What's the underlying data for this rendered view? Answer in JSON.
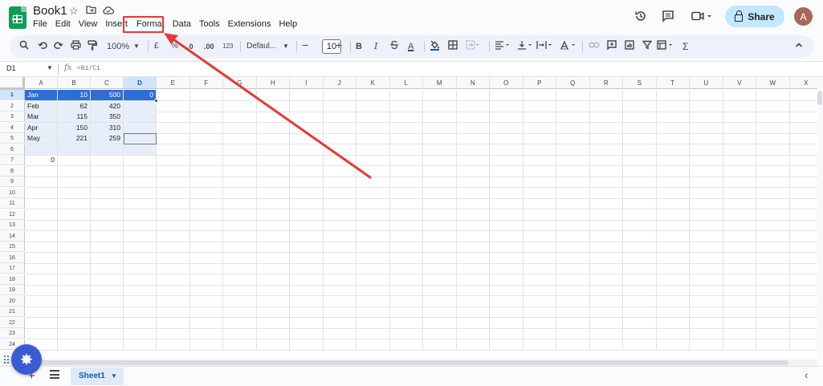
{
  "document": {
    "title": "Book1",
    "title_icons": [
      "star-icon",
      "move-to-folder-icon",
      "cloud-status-icon"
    ]
  },
  "menu": [
    "File",
    "Edit",
    "View",
    "Insert",
    "Format",
    "Data",
    "Tools",
    "Extensions",
    "Help"
  ],
  "highlighted_menu": "Format",
  "header_actions": {
    "icons": [
      "version-history-icon",
      "comments-icon",
      "meet-icon"
    ],
    "share_label": "Share",
    "avatar_initial": "A"
  },
  "toolbar": {
    "zoom": "100%",
    "currency": "£",
    "percent": "%",
    "decrease_decimal": ".0",
    "increase_decimal": ".00",
    "number_format": "123",
    "font": "Defaul...",
    "font_size": "10",
    "bold": "B",
    "italic": "I",
    "text_color": "A",
    "sum": "Σ"
  },
  "formula_bar": {
    "cell_ref": "D1",
    "fx": "fx",
    "formula": "=B1/C1"
  },
  "grid": {
    "columns": [
      "A",
      "B",
      "C",
      "D",
      "E",
      "F",
      "G",
      "H",
      "I",
      "J",
      "K",
      "L",
      "M",
      "N",
      "O",
      "P",
      "Q",
      "R",
      "S",
      "T",
      "U",
      "V",
      "W",
      "X"
    ],
    "active_column": "D",
    "row_numbers": [
      "1",
      "2",
      "3",
      "4",
      "5",
      "6",
      "7",
      "8",
      "9",
      "10",
      "11",
      "12",
      "13",
      "14",
      "15",
      "16",
      "17",
      "18",
      "19",
      "20",
      "21",
      "22",
      "23",
      "24"
    ],
    "active_row": "1",
    "rows": [
      [
        "Jan",
        "10",
        "500",
        "0"
      ],
      [
        "Feb",
        "62",
        "420",
        ""
      ],
      [
        "Mar",
        "115",
        "350",
        ""
      ],
      [
        "Apr",
        "150",
        "310",
        ""
      ],
      [
        "May",
        "221",
        "259",
        ""
      ],
      [
        "",
        "",
        "",
        ""
      ],
      [
        "0",
        "",
        "",
        ""
      ]
    ]
  },
  "colors": {
    "accent": "#0b57d0",
    "selected_row": "#2f6cd6",
    "annotation": "#e53935",
    "share_bg": "#c2e7ff"
  },
  "sheets": {
    "tabs": [
      "Sheet1"
    ],
    "active": "Sheet1"
  }
}
